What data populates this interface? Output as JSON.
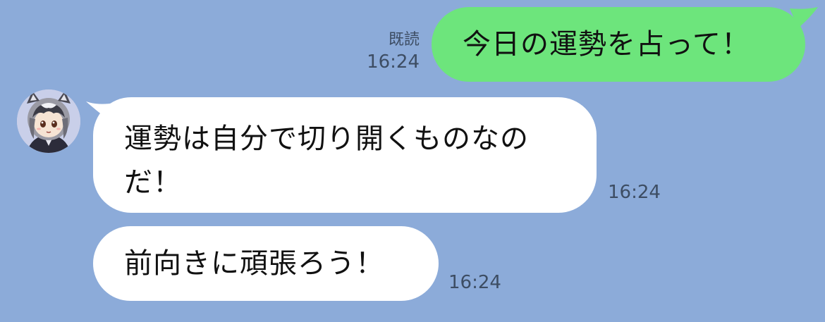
{
  "messages": {
    "outgoing": {
      "text": "今日の運勢を占って！",
      "read_label": "既読",
      "time": "16:24"
    },
    "incoming_1": {
      "lines": [
        "運勢は自分で切り開くものなの",
        "だ！"
      ],
      "time": "16:24"
    },
    "incoming_2": {
      "text": "前向きに頑張ろう！",
      "time": "16:24"
    }
  },
  "colors": {
    "background": "#8cabd9",
    "outgoing_bubble": "#6de57c",
    "incoming_bubble": "#ffffff",
    "meta_text": "#3d4d63"
  },
  "icons": {
    "avatar": "raccoon-character-avatar"
  }
}
